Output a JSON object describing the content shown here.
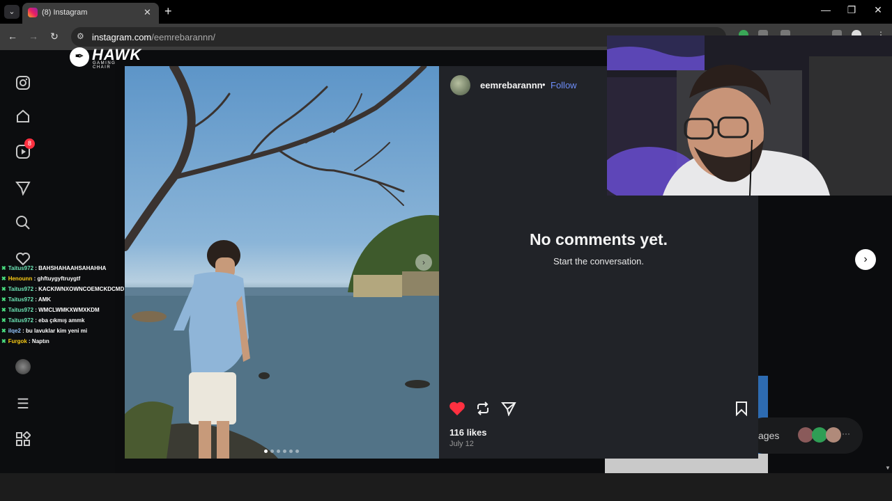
{
  "browser": {
    "tab_title": "(8) Instagram",
    "url_domain": "instagram.com",
    "url_path": "/eemrebarannn/",
    "icons": [
      "chevron-down-icon",
      "instagram-favicon",
      "close-icon",
      "plus-icon",
      "minimize-icon",
      "maximize-icon",
      "close-window-icon",
      "back-arrow-icon",
      "forward-arrow-icon",
      "reload-icon",
      "site-settings-icon"
    ]
  },
  "overlay_logo": {
    "name": "HAWK",
    "sub": "GAMING CHAIR"
  },
  "sidebar": {
    "notification_count": "8",
    "items": [
      "instagram-icon",
      "home-icon",
      "reels-icon",
      "messages-icon",
      "search-icon",
      "notifications-icon",
      "profile-icon",
      "menu-icon",
      "more-icon"
    ]
  },
  "post": {
    "username": "eemrebarannn",
    "separator": "•",
    "follow_label": "Follow",
    "no_comments": "No comments yet.",
    "start_conversation": "Start the conversation.",
    "likes": "116 likes",
    "date": "July 12",
    "liked": true,
    "image_index": 1,
    "image_count": 6
  },
  "background": {
    "messages_label": "ages"
  },
  "chat": [
    {
      "user": "Taitus972",
      "msg": "BAHSHAHAAHSAHAHHA",
      "style": "a"
    },
    {
      "user": "Henounn",
      "msg": "ghftuygyftruygtf",
      "style": "b"
    },
    {
      "user": "Taitus972",
      "msg": "KACKIWNXOWNCOEMCKDCMD",
      "style": "a"
    },
    {
      "user": "Taitus972",
      "msg": "AMK",
      "style": "a"
    },
    {
      "user": "Taitus972",
      "msg": "WMCLWMKXWMXKDM",
      "style": "a"
    },
    {
      "user": "Taitus972",
      "msg": "eba çıkmış ammk",
      "style": "a"
    },
    {
      "user": "ilqe2",
      "msg": "bu lavuklar kim yeni mi",
      "style": "c"
    },
    {
      "user": "Furgok",
      "msg": "Naptın",
      "style": "b"
    }
  ],
  "colors": {
    "like_red": "#ff3040",
    "follow_blue": "#6d8df8",
    "panel_bg": "#212328"
  }
}
